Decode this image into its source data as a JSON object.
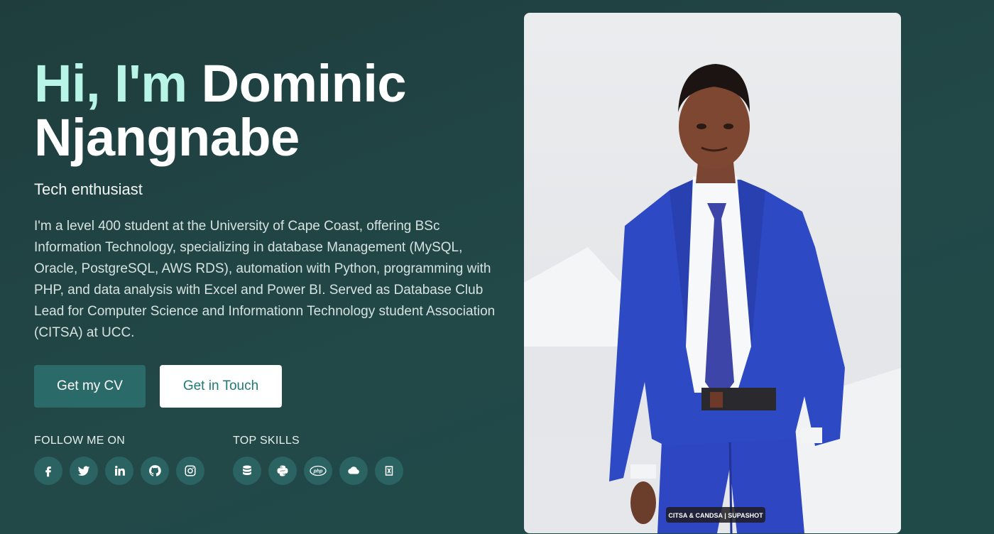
{
  "hero": {
    "greeting": "Hi, I'm",
    "name_line1": "Dominic",
    "name_line2": "Njangnabe",
    "tagline": "Tech enthusiast",
    "bio": "I'm a level 400 student at the University of Cape Coast, offering BSc Information Technology, specializing in database Management (MySQL, Oracle, PostgreSQL, AWS RDS), automation with Python, programming with PHP, and data analysis with Excel and Power BI. Served as Database Club Lead for Computer Science and Informationn Technology student Association (CITSA) at UCC."
  },
  "buttons": {
    "cv": "Get my CV",
    "contact": "Get in Touch"
  },
  "follow": {
    "heading": "FOLLOW ME ON",
    "icons": [
      "facebook-icon",
      "twitter-icon",
      "linkedin-icon",
      "github-icon",
      "instagram-icon"
    ]
  },
  "skills": {
    "heading": "TOP SKILLS",
    "icons": [
      "database-icon",
      "python-icon",
      "php-icon",
      "cloud-icon",
      "excel-icon"
    ]
  },
  "photo": {
    "caption": "CITSA & CANDSA | SUPASHOT"
  },
  "colors": {
    "accent": "#b9f5e6",
    "primary_button": "#2a6b69",
    "icon_circle": "#2b6362",
    "background": "#224848"
  }
}
